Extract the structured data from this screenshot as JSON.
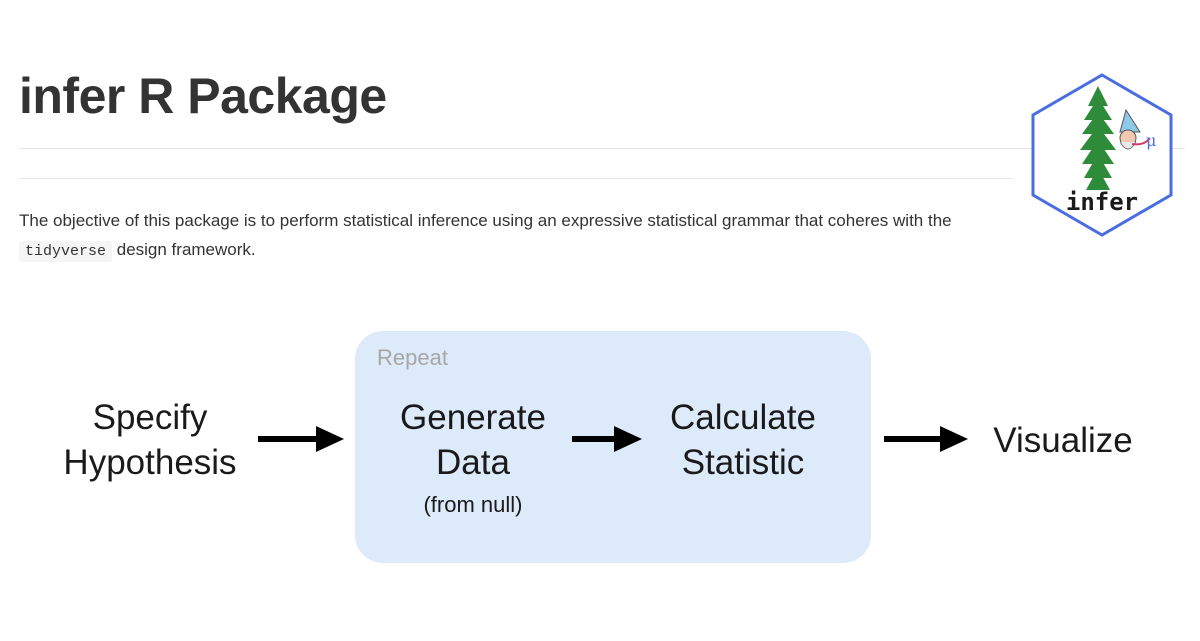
{
  "page": {
    "title": "infer R Package"
  },
  "intro": {
    "text_before": "The objective of this package is to perform statistical inference using an expressive statistical grammar that coheres with the ",
    "code": "tidyverse",
    "text_after": " design framework."
  },
  "logo": {
    "text": "infer",
    "glyph": "μ",
    "border_color": "#4a6ee0",
    "tree_color": "#2e8b3a"
  },
  "diagram": {
    "repeat_label": "Repeat",
    "repeat_box_color": "#ddeafa",
    "steps": [
      {
        "lines": [
          "Specify",
          "Hypothesis"
        ]
      },
      {
        "lines": [
          "Generate",
          "Data"
        ],
        "sub": "(from null)"
      },
      {
        "lines": [
          "Calculate",
          "Statistic"
        ]
      },
      {
        "lines": [
          "Visualize"
        ]
      }
    ]
  }
}
